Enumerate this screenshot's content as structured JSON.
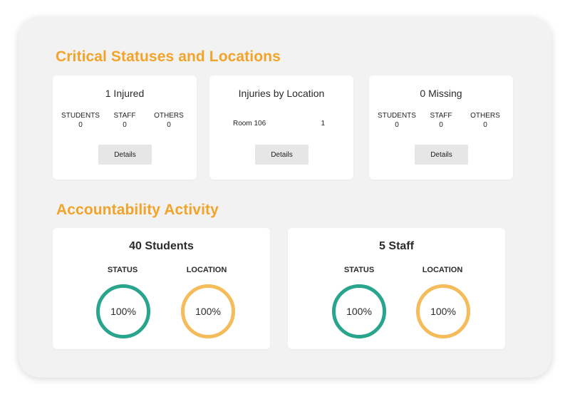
{
  "critical": {
    "title": "Critical Statuses and Locations",
    "injured": {
      "title": "1 Injured",
      "counts": [
        {
          "label": "STUDENTS",
          "value": "0"
        },
        {
          "label": "STAFF",
          "value": "0"
        },
        {
          "label": "OTHERS",
          "value": "0"
        }
      ],
      "details_label": "Details"
    },
    "injuries_by_location": {
      "title": "Injuries by Location",
      "rows": [
        {
          "location": "Room 106",
          "count": "1"
        }
      ],
      "details_label": "Details"
    },
    "missing": {
      "title": "0 Missing",
      "counts": [
        {
          "label": "STUDENTS",
          "value": "0"
        },
        {
          "label": "STAFF",
          "value": "0"
        },
        {
          "label": "OTHERS",
          "value": "0"
        }
      ],
      "details_label": "Details"
    }
  },
  "accountability": {
    "title": "Accountability Activity",
    "students": {
      "title": "40 Students",
      "status_label": "STATUS",
      "status_value": "100%",
      "location_label": "LOCATION",
      "location_value": "100%"
    },
    "staff": {
      "title": "5 Staff",
      "status_label": "STATUS",
      "status_value": "100%",
      "location_label": "LOCATION",
      "location_value": "100%"
    }
  },
  "colors": {
    "accent_orange": "#f2a42a",
    "status_ring": "#2aa58d",
    "location_ring": "#f5bc5c",
    "panel_bg": "#f2f2f2"
  }
}
